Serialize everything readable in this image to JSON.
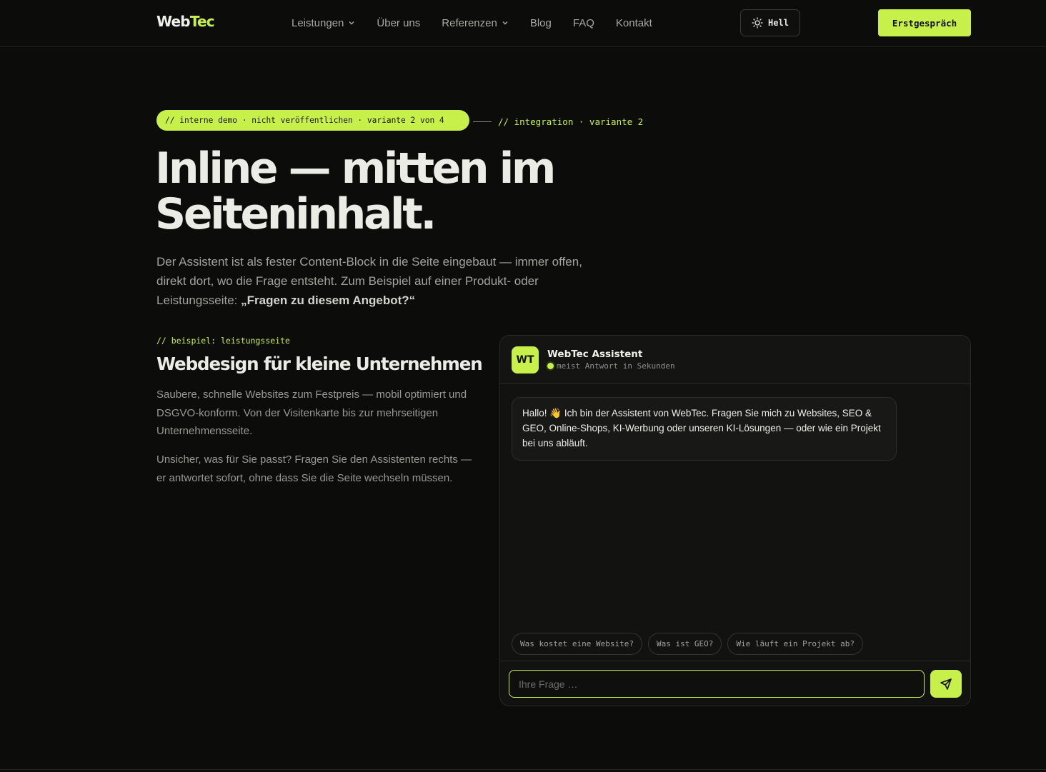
{
  "header": {
    "logo_main": "Web",
    "logo_accent": "Tec",
    "nav": [
      {
        "label": "Leistungen",
        "has_dropdown": true
      },
      {
        "label": "Über uns",
        "has_dropdown": false
      },
      {
        "label": "Referenzen",
        "has_dropdown": true
      },
      {
        "label": "Blog",
        "has_dropdown": false
      },
      {
        "label": "FAQ",
        "has_dropdown": false
      },
      {
        "label": "Kontakt",
        "has_dropdown": false
      }
    ],
    "theme_toggle_label": "Hell",
    "theme_toggle_icon": "sun-icon",
    "cta_label": "Erstgespräch"
  },
  "hero": {
    "pill_text": "// interne demo · nicht veröffentlichen · variante 2 von 4",
    "integration_tag": "// integration · variante 2",
    "title_line1": "Inline — mitten im",
    "title_line2": "Seiteninhalt.",
    "lead_text": "Der Assistent ist als fester Content-Block in die Seite eingebaut — immer offen, direkt dort, wo die Frage entsteht. Zum Beispiel auf einer Produkt- oder Leistungsseite: ",
    "lead_emphasis": "„Fragen zu diesem Angebot?“"
  },
  "example": {
    "tag": "// beispiel: leistungsseite",
    "title": "Webdesign für kleine Unternehmen",
    "paragraph1": "Saubere, schnelle Websites zum Festpreis — mobil optimiert und DSGVO-konform. Von der Visitenkarte bis zur mehrseitigen Unternehmensseite.",
    "paragraph2": "Unsicher, was für Sie passt? Fragen Sie den Assistenten rechts — er antwortet sofort, ohne dass Sie die Seite wechseln müssen."
  },
  "chat": {
    "avatar_initials": "WT",
    "title": "WebTec Assistent",
    "status": "meist Antwort in Sekunden",
    "greeting": "Hallo! 👋 Ich bin der Assistent von WebTec. Fragen Sie mich zu Websites, SEO & GEO, Online-Shops, KI-Werbung oder unseren KI-Lösungen — oder wie ein Projekt bei uns abläuft.",
    "suggestions": [
      "Was kostet eine Website?",
      "Was ist GEO?",
      "Wie läuft ein Projekt ab?"
    ],
    "input_placeholder": "Ihre Frage …",
    "send_icon": "send-icon"
  },
  "colors": {
    "accent": "#c8f04a",
    "background": "#0c0c0b",
    "panel": "#121211"
  }
}
